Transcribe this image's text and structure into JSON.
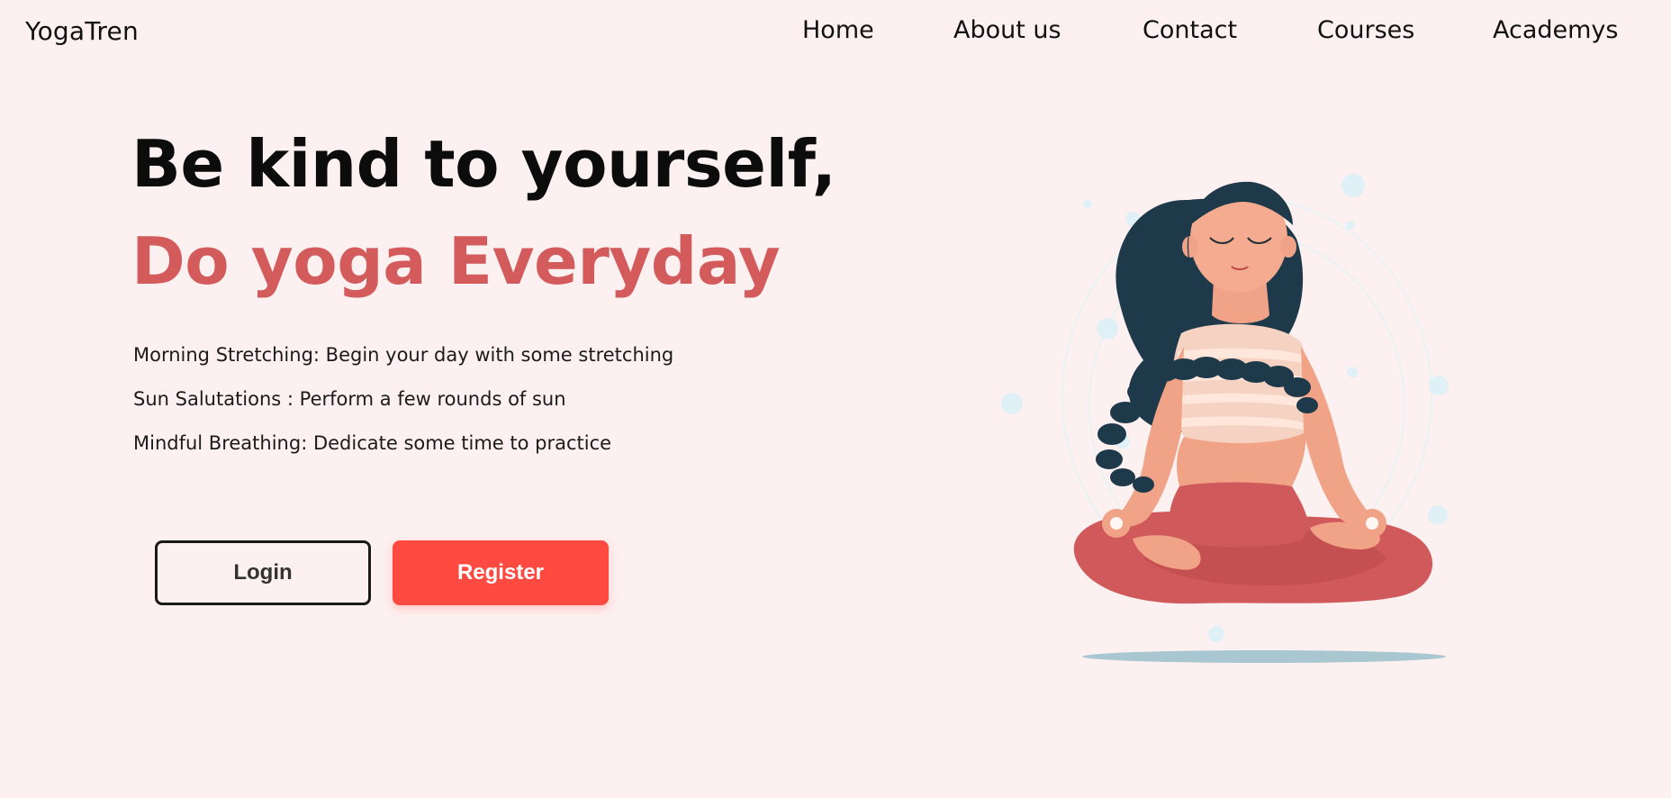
{
  "header": {
    "logo": "YogaTren",
    "nav": [
      {
        "label": "Home"
      },
      {
        "label": "About us"
      },
      {
        "label": "Contact"
      },
      {
        "label": "Courses"
      },
      {
        "label": "Academys"
      }
    ]
  },
  "hero": {
    "title_line1": "Be kind to yourself,",
    "title_line2": "Do yoga Everyday",
    "features": [
      "Morning Stretching: Begin your day with some stretching",
      "Sun Salutations : Perform a few rounds of sun",
      "Mindful Breathing: Dedicate some time to practice"
    ],
    "login_label": "Login",
    "register_label": "Register"
  },
  "colors": {
    "background": "#fdf0f0",
    "accent": "#d35b5b",
    "register_button": "#ff4a42"
  },
  "icons": {
    "illustration": "meditating-woman-illustration"
  }
}
